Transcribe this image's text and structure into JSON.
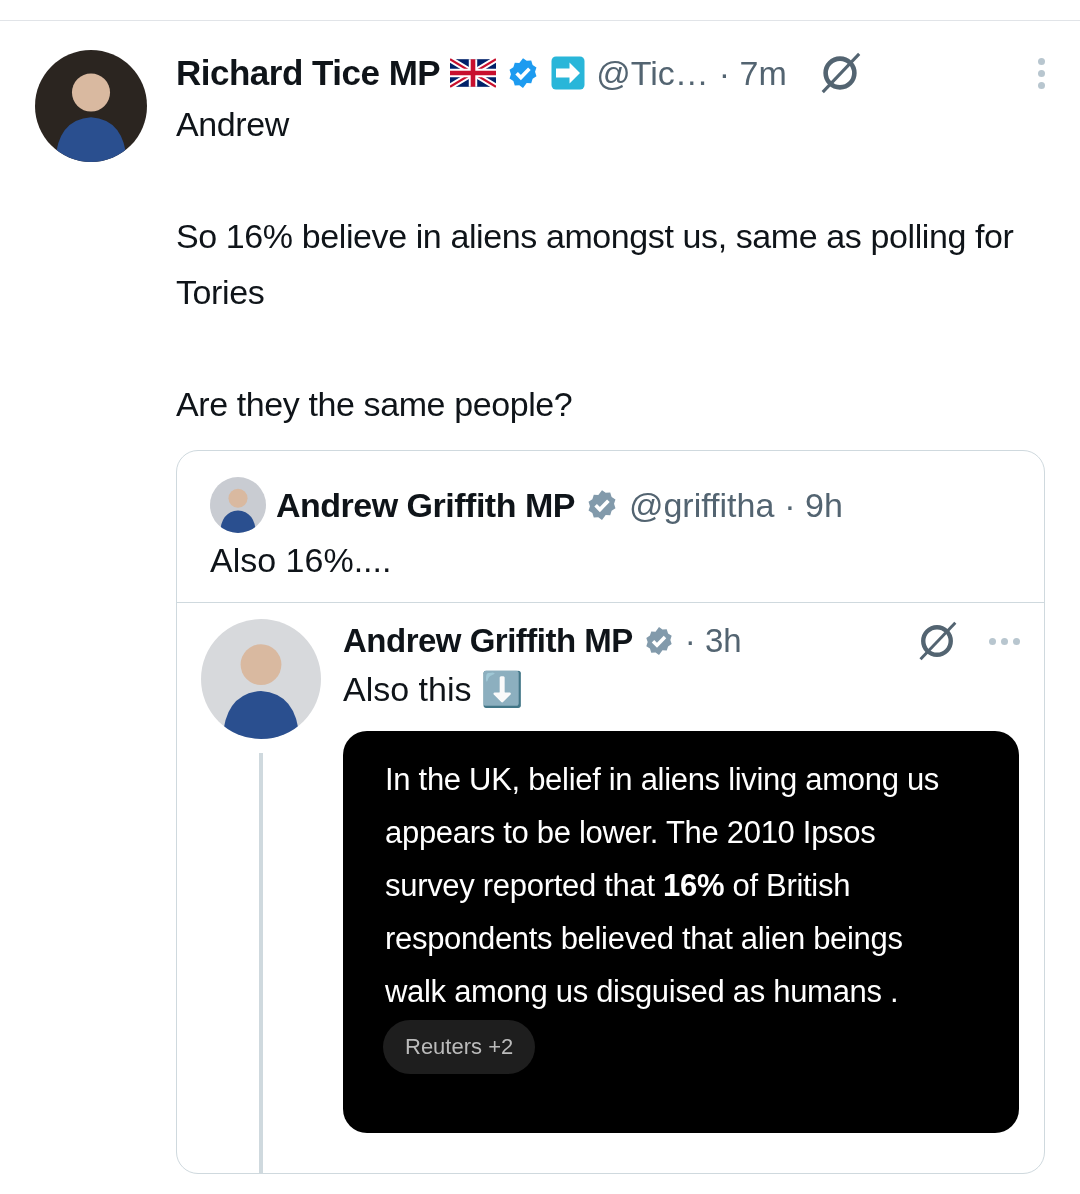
{
  "tweet": {
    "author": "Richard Tice MP",
    "handle": "@Tic…",
    "time": "· 7m",
    "verified": true,
    "paragraphs": [
      "Andrew",
      "So 16% believe in aliens amongst us, same as polling for Tories",
      "Are they the same people?"
    ],
    "quote": {
      "author": "Andrew Griffith MP",
      "handle": "@griffitha",
      "time": "· 9h",
      "verified": true,
      "text": "Also 16%....",
      "embedded": {
        "author": "Andrew Griffith MP",
        "time": "· 3h",
        "verified": true,
        "text": "Also this ⬇️",
        "image_text": "In the UK, belief in aliens living among us appears to be lower. The 2010 Ipsos survey reported that **16%** of British respondents believed that alien beings walk among us disguised as humans .",
        "source": "Reuters +2"
      }
    }
  }
}
